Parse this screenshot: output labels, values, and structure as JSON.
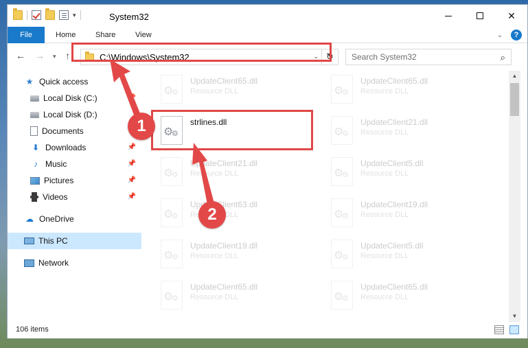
{
  "window": {
    "title": "System32",
    "controls": {
      "minimize": "",
      "maximize": "",
      "close": "✕"
    }
  },
  "ribbon": {
    "tabs": [
      {
        "label": "File"
      },
      {
        "label": "Home"
      },
      {
        "label": "Share"
      },
      {
        "label": "View"
      }
    ],
    "help": "?"
  },
  "nav": {
    "back": "←",
    "forward": "→",
    "up": "↑",
    "address": "C:\\Windows\\System32",
    "refresh": "↻",
    "search_placeholder": "Search System32"
  },
  "sidebar": {
    "items": [
      {
        "label": "Quick access",
        "icon": "star-icon"
      },
      {
        "label": "Local Disk (C:)",
        "icon": "drive-icon"
      },
      {
        "label": "Local Disk (D:)",
        "icon": "drive-icon"
      },
      {
        "label": "Documents",
        "icon": "documents-icon"
      },
      {
        "label": "Downloads",
        "icon": "download-icon"
      },
      {
        "label": "Music",
        "icon": "music-icon"
      },
      {
        "label": "Pictures",
        "icon": "pictures-icon"
      },
      {
        "label": "Videos",
        "icon": "videos-icon"
      },
      {
        "label": "OneDrive",
        "icon": "cloud-icon"
      },
      {
        "label": "This PC",
        "icon": "computer-icon"
      },
      {
        "label": "Network",
        "icon": "network-icon"
      }
    ]
  },
  "files": {
    "left_column": [
      {
        "name": "UpdateClient65.dll",
        "type": "Resource DLL"
      },
      {
        "name": "strlines.dll",
        "type": ""
      },
      {
        "name": "UpdateClient21.dll",
        "type": "Resource DLL"
      },
      {
        "name": "UpdateClient63.dll",
        "type": "Resource DLL"
      },
      {
        "name": "UpdateClient19.dll",
        "type": "Resource DLL"
      },
      {
        "name": "UpdateClient65.dll",
        "type": "Resource DLL"
      }
    ],
    "right_column": [
      {
        "name": "UpdateClient65.dll",
        "type": "Resource DLL"
      },
      {
        "name": "UpdateClient21.dll",
        "type": "Resource DLL"
      },
      {
        "name": "UpdateClient5.dll",
        "type": "Resource DLL"
      },
      {
        "name": "UpdateClient19.dll",
        "type": "Resource DLL"
      },
      {
        "name": "UpdateClient5.dll",
        "type": "Resource DLL"
      },
      {
        "name": "UpdateClient65.dll",
        "type": "Resource DLL"
      }
    ]
  },
  "status": {
    "item_count": "106 items"
  },
  "annotations": {
    "step1": "1",
    "step2": "2",
    "color": "#e04646"
  }
}
